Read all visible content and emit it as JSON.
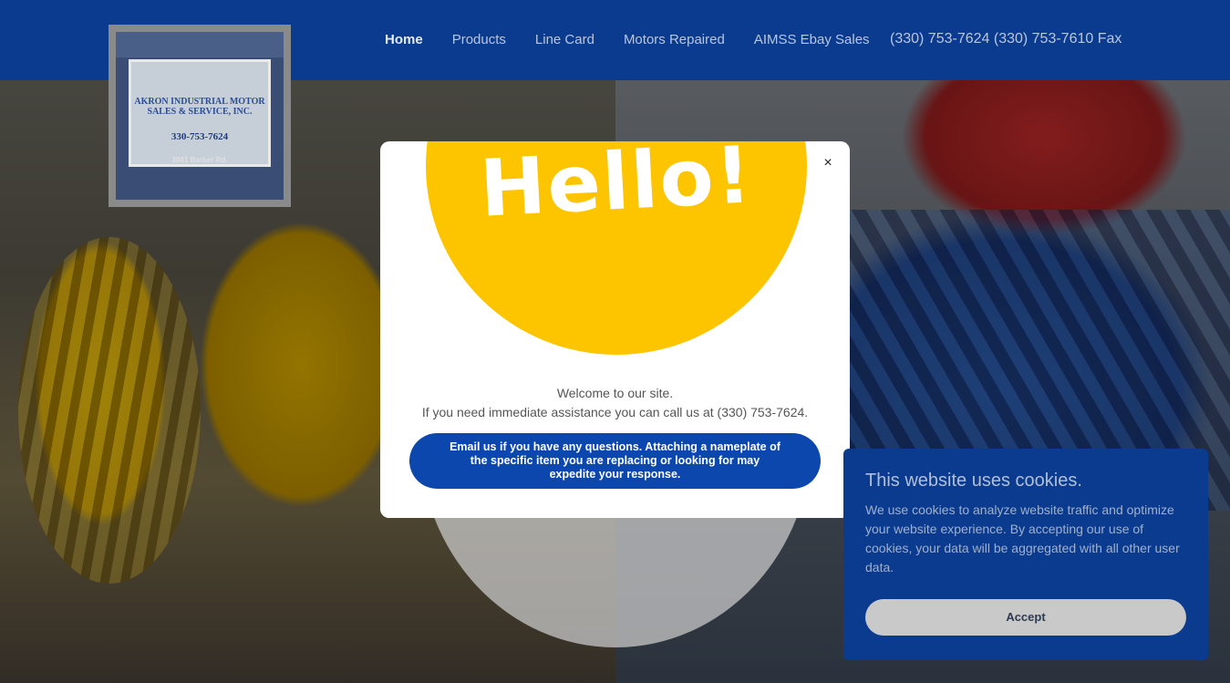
{
  "logo": {
    "line1": "AKRON INDUSTRIAL MOTOR",
    "line2": "SALES & SERVICE, INC.",
    "phone": "330-753-7624",
    "address": "3041 Barber Rd."
  },
  "nav": {
    "items": [
      {
        "label": "Home",
        "active": true
      },
      {
        "label": "Products"
      },
      {
        "label": "Line Card"
      },
      {
        "label": "Motors Repaired"
      },
      {
        "label": "AIMSS Ebay Sales"
      }
    ]
  },
  "header": {
    "phone": "(330) 753-7624 (330) 753-7610 Fax"
  },
  "modal": {
    "hello": "Hello!",
    "close": "×",
    "welcome": "Welcome to our site.",
    "assistance": "If you need immediate assistance you can call us at (330) 753-7624.",
    "email_button": "Email us if you have any questions. Attaching a nameplate of the specific item you are replacing or looking for may expedite your response."
  },
  "cookie": {
    "title": "This website uses cookies.",
    "body": "We use cookies to analyze website traffic and optimize your website experience. By accepting our use of cookies, your data will be aggregated with all other user data.",
    "accept": "Accept"
  },
  "colors": {
    "header": "#0b3b8f",
    "button": "#0b47ad",
    "hello_yellow": "#fdc500"
  }
}
